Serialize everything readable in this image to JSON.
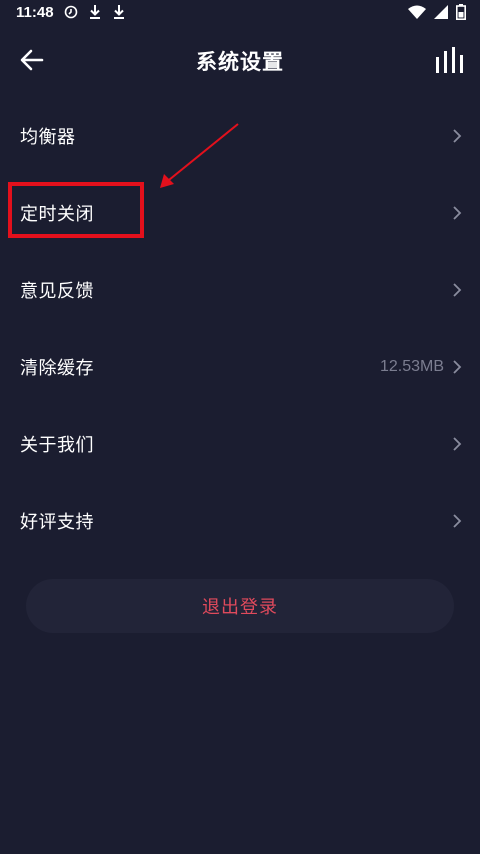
{
  "status_bar": {
    "time": "11:48",
    "left_icons": [
      "clock-icon",
      "download-icon",
      "download-icon"
    ],
    "right_icons": [
      "wifi-icon",
      "signal-icon",
      "battery-icon"
    ]
  },
  "header": {
    "title": "系统设置",
    "back_icon": "arrow-left-icon",
    "action_icon": "equalizer-icon"
  },
  "menu": {
    "items": [
      {
        "label": "均衡器",
        "value": ""
      },
      {
        "label": "定时关闭",
        "value": ""
      },
      {
        "label": "意见反馈",
        "value": ""
      },
      {
        "label": "清除缓存",
        "value": "12.53MB"
      },
      {
        "label": "关于我们",
        "value": ""
      },
      {
        "label": "好评支持",
        "value": ""
      }
    ]
  },
  "logout": {
    "label": "退出登录"
  },
  "colors": {
    "background": "#1b1d30",
    "highlight": "#e3101c",
    "logout_text": "#e04a5c",
    "secondary_text": "#7b7d90"
  }
}
